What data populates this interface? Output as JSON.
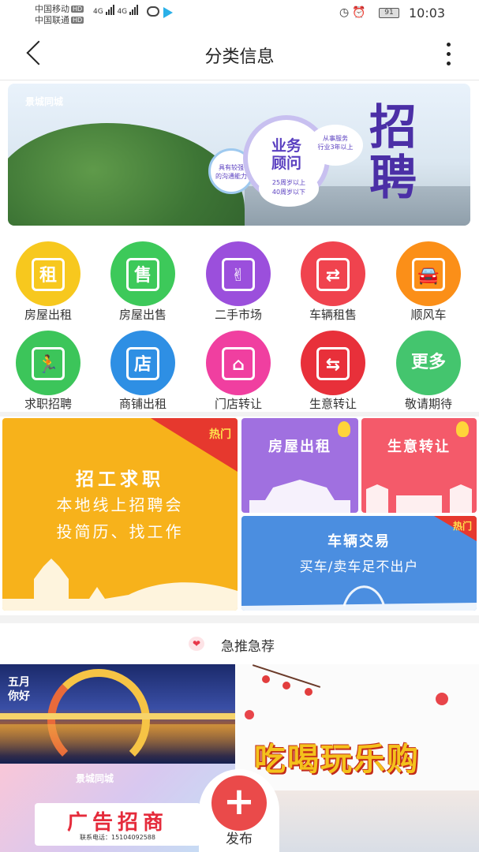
{
  "status_bar": {
    "carrier1": "中国移动",
    "carrier2": "中国联通",
    "hd": "HD",
    "network": "4G",
    "battery": "91",
    "time": "10:03"
  },
  "header": {
    "title": "分类信息",
    "back_icon": "back-arrow-icon",
    "more_icon": "more-vertical-icon"
  },
  "banner": {
    "logo_text": "景城同城",
    "bubble_main": "业务\n顾问",
    "bubble_left": "具有较强\n的沟通能力",
    "bubble_right": "从事服务\n行业3年以上",
    "bubble_bottom": "25周岁以上\n40周岁以下",
    "big_text": "招\n聘"
  },
  "categories": [
    {
      "label": "房屋出租",
      "color": "#f7c81e",
      "glyph": "租"
    },
    {
      "label": "房屋出售",
      "color": "#3dc95a",
      "glyph": "售"
    },
    {
      "label": "二手市场",
      "color": "#9b4fdc",
      "glyph": "✌"
    },
    {
      "label": "车辆租售",
      "color": "#f0434e",
      "glyph": "⇄"
    },
    {
      "label": "顺风车",
      "color": "#fb8f18",
      "glyph": "🚘"
    },
    {
      "label": "求职招聘",
      "color": "#3cc55a",
      "glyph": "🏃"
    },
    {
      "label": "商铺出租",
      "color": "#2e8fe4",
      "glyph": "店"
    },
    {
      "label": "门店转让",
      "color": "#f03fa0",
      "glyph": "⌂"
    },
    {
      "label": "生意转让",
      "color": "#e8303a",
      "glyph": "⇆"
    },
    {
      "label": "敬请期待",
      "color": "#44c56e",
      "glyph": "更多"
    }
  ],
  "promos": {
    "jobs": {
      "hot": "热门",
      "title": "招工求职",
      "line1": "本地线上招聘会",
      "line2": "投简历、找工作",
      "color": "#f7b21b"
    },
    "house": {
      "title": "房屋出租",
      "color": "#a070e0"
    },
    "business": {
      "title": "生意转让",
      "color": "#f45a6a"
    },
    "car": {
      "hot": "热门",
      "title": "车辆交易",
      "subtitle": "买车/卖车足不出户",
      "color": "#4b8ee0"
    }
  },
  "recommend": {
    "title": "急推急荐",
    "heart_icon": "heart-icon",
    "ad_night_badge": "五月\n你好",
    "ad_fun_headline": "吃喝玩乐购",
    "ad_recruit_logo": "景城同城",
    "ad_recruit_big": "广告招商",
    "ad_recruit_tel": "联系电话：15104092588"
  },
  "publish": {
    "label": "发布",
    "icon": "plus-icon"
  }
}
